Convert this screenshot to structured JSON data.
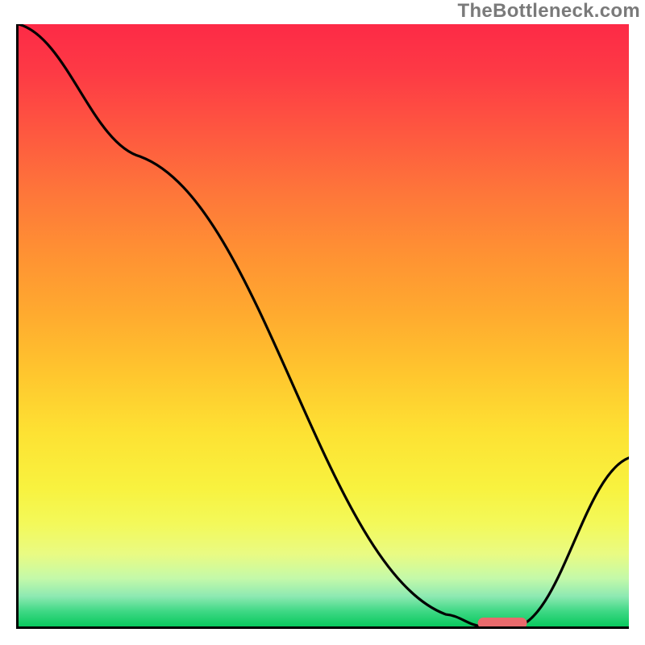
{
  "watermark": "TheBottleneck.com",
  "chart_data": {
    "type": "line",
    "title": "",
    "xlabel": "",
    "ylabel": "",
    "xlim": [
      0,
      100
    ],
    "ylim": [
      0,
      100
    ],
    "grid": false,
    "legend": false,
    "series": [
      {
        "name": "bottleneck-curve",
        "x": [
          0,
          20,
          70,
          76,
          82,
          100
        ],
        "values": [
          100,
          78,
          2,
          0,
          0,
          28
        ]
      }
    ],
    "marker": {
      "name": "optimal-range",
      "x_center": 79,
      "y": 0,
      "width_pct": 8,
      "color": "#e86a6c"
    },
    "gradient_stops": [
      {
        "pct": 0,
        "color": "#fd2a46"
      },
      {
        "pct": 8,
        "color": "#fd3a45"
      },
      {
        "pct": 18,
        "color": "#fe5840"
      },
      {
        "pct": 28,
        "color": "#fe763a"
      },
      {
        "pct": 38,
        "color": "#ff9133"
      },
      {
        "pct": 48,
        "color": "#ffaa2f"
      },
      {
        "pct": 58,
        "color": "#ffc62e"
      },
      {
        "pct": 68,
        "color": "#fde233"
      },
      {
        "pct": 77,
        "color": "#f8f23f"
      },
      {
        "pct": 83,
        "color": "#f3f95a"
      },
      {
        "pct": 88,
        "color": "#e9fb83"
      },
      {
        "pct": 92,
        "color": "#c4f9a9"
      },
      {
        "pct": 95,
        "color": "#8de9b2"
      },
      {
        "pct": 97.5,
        "color": "#3ed884"
      },
      {
        "pct": 100,
        "color": "#09c95e"
      }
    ]
  }
}
